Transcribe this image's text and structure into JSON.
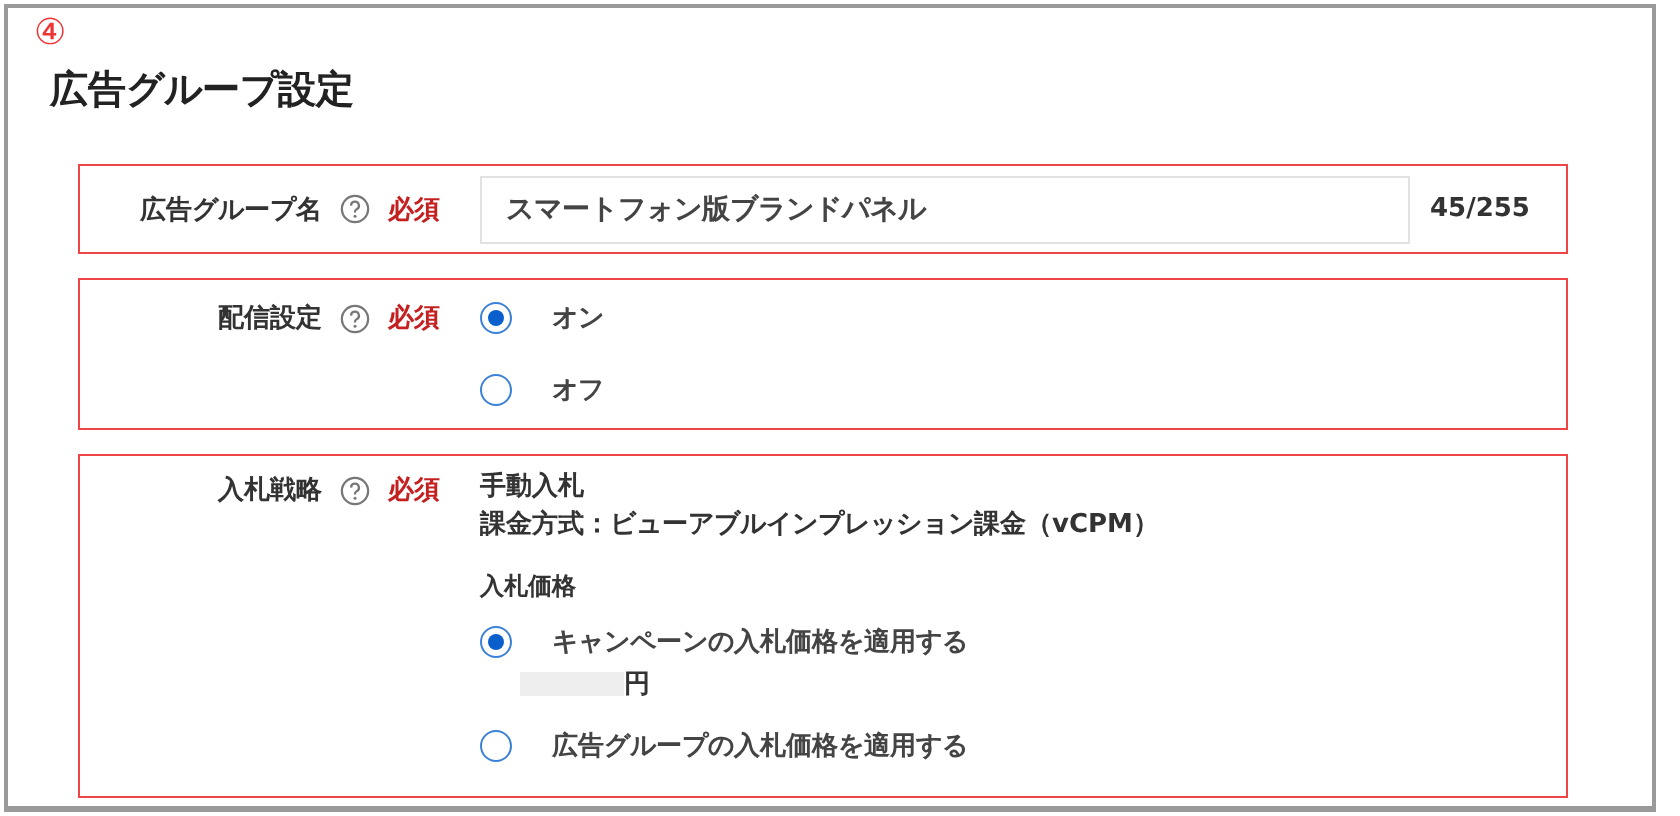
{
  "annotation": "④",
  "title": "広告グループ設定",
  "fields": [
    {
      "kind": "text",
      "label": "広告グループ名",
      "required": "必須",
      "value": "スマートフォン版ブランドパネル",
      "counter": "45/255"
    },
    {
      "kind": "radio",
      "label": "配信設定",
      "required": "必須",
      "options": [
        {
          "label": "オン",
          "selected": true
        },
        {
          "label": "オフ",
          "selected": false
        }
      ]
    },
    {
      "kind": "bid",
      "label": "入札戦略",
      "required": "必須",
      "lines": [
        "手動入札",
        "課金方式：ビューアブルインプレッション課金（vCPM）"
      ],
      "subheading": "入札価格",
      "options": [
        {
          "label": "キャンペーンの入札価格を適用する",
          "selected": true,
          "unit": "円"
        },
        {
          "label": "広告グループの入札価格を適用する",
          "selected": false
        }
      ]
    }
  ]
}
